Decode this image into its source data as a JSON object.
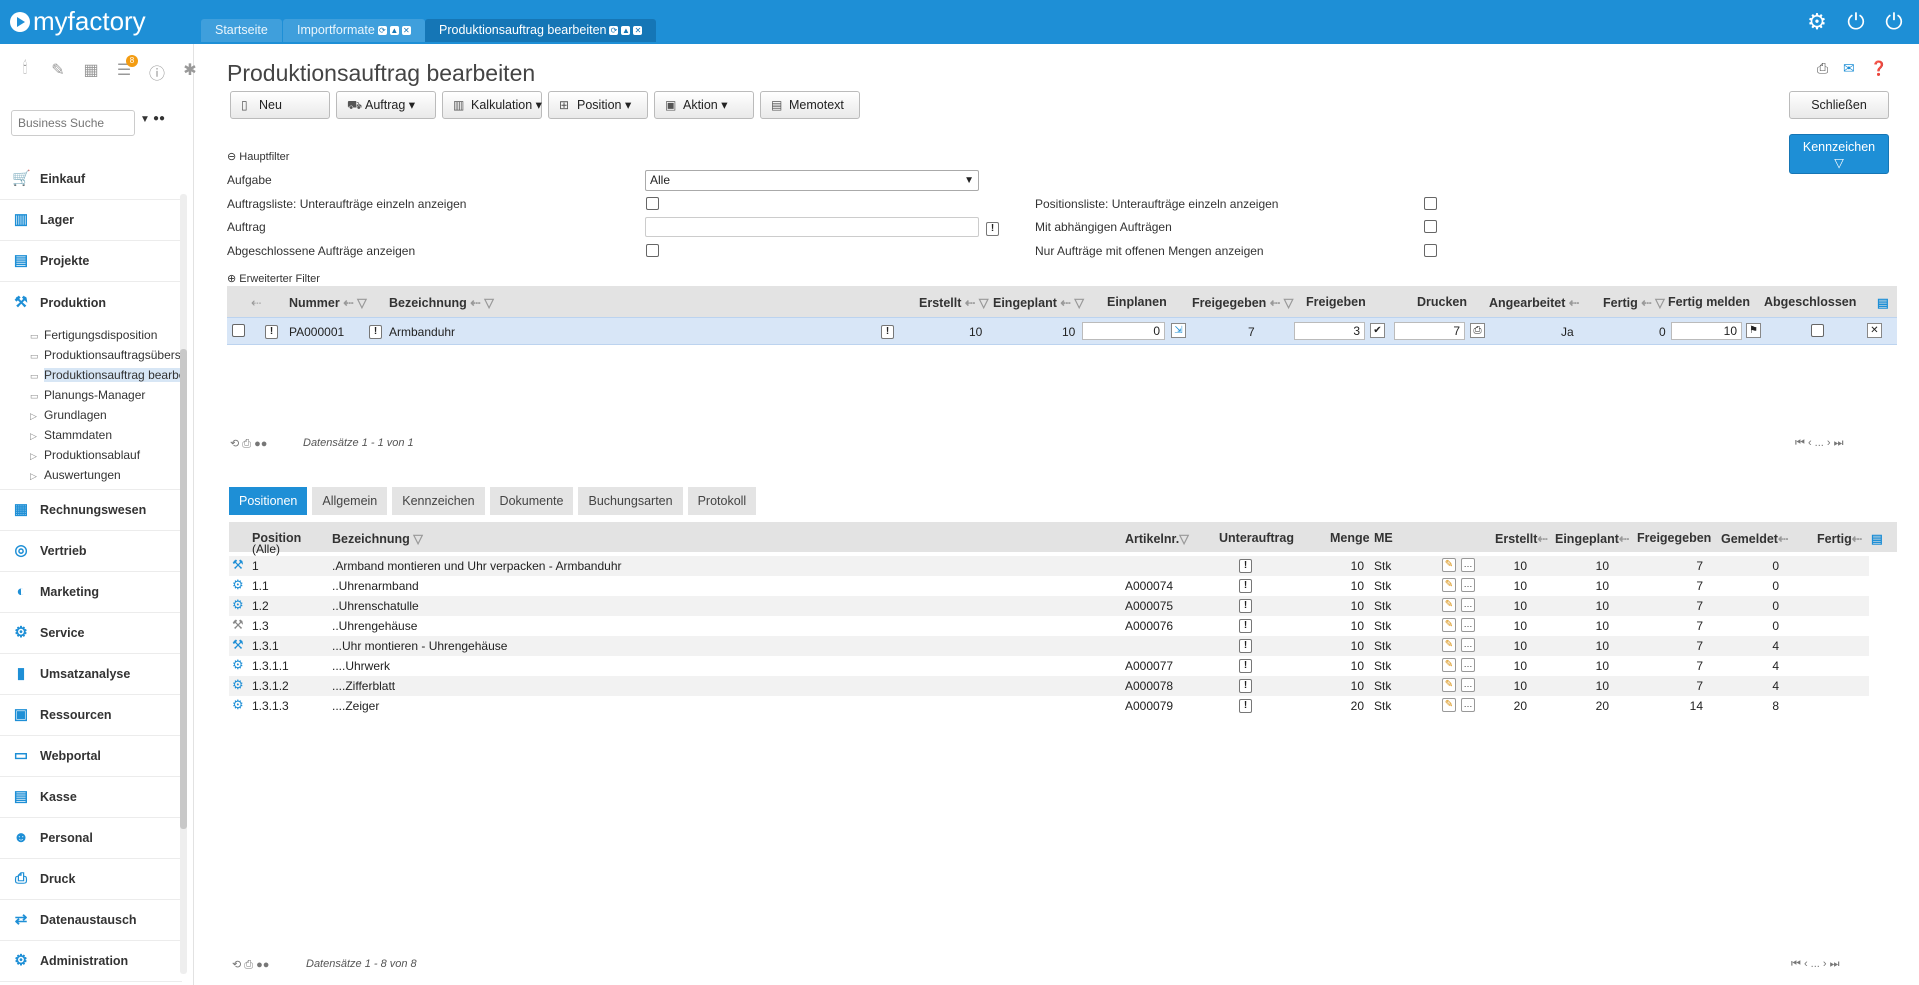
{
  "app": {
    "logo_text": "myfactory",
    "accent": "#1e8fd6"
  },
  "tabs": [
    {
      "label": "Startseite"
    },
    {
      "label": "Importformate"
    },
    {
      "label": "Produktionsauftrag bearbeiten"
    }
  ],
  "sidebar": {
    "badge": "8",
    "search_placeholder": "Business Suche",
    "modules": [
      {
        "label": "Einkauf",
        "icon": "cart-icon"
      },
      {
        "label": "Lager",
        "icon": "warehouse-icon"
      },
      {
        "label": "Projekte",
        "icon": "projects-icon"
      },
      {
        "label": "Produktion",
        "icon": "production-icon"
      }
    ],
    "sub": [
      {
        "label": "Fertigungsdisposition"
      },
      {
        "label": "Produktionsauftragsübers"
      },
      {
        "label": "Produktionsauftrag bearbe"
      },
      {
        "label": "Planungs-Manager"
      },
      {
        "label": "Grundlagen"
      },
      {
        "label": "Stammdaten"
      },
      {
        "label": "Produktionsablauf"
      },
      {
        "label": "Auswertungen"
      }
    ],
    "modules2": [
      {
        "label": "Rechnungswesen",
        "icon": "accounting-icon"
      },
      {
        "label": "Vertrieb",
        "icon": "sales-icon"
      },
      {
        "label": "Marketing",
        "icon": "marketing-icon"
      },
      {
        "label": "Service",
        "icon": "service-icon"
      },
      {
        "label": "Umsatzanalyse",
        "icon": "analysis-icon"
      },
      {
        "label": "Ressourcen",
        "icon": "resources-icon"
      },
      {
        "label": "Webportal",
        "icon": "webportal-icon"
      },
      {
        "label": "Kasse",
        "icon": "cashdesk-icon"
      },
      {
        "label": "Personal",
        "icon": "staff-icon"
      },
      {
        "label": "Druck",
        "icon": "print-icon"
      },
      {
        "label": "Datenaustausch",
        "icon": "exchange-icon"
      },
      {
        "label": "Administration",
        "icon": "admin-icon"
      }
    ]
  },
  "page": {
    "title": "Produktionsauftrag bearbeiten"
  },
  "toolbar": {
    "neu": "Neu",
    "auftrag": "Auftrag",
    "kalkulation": "Kalkulation",
    "position": "Position",
    "aktion": "Aktion",
    "memotext": "Memotext",
    "schliessen": "Schließen",
    "kennzeichen": "Kennzeichen"
  },
  "filter": {
    "hauptfilter": "Hauptfilter",
    "aufgabe_label": "Aufgabe",
    "aufgabe_value": "Alle",
    "auftragsliste_label": "Auftragsliste: Unteraufträge einzeln anzeigen",
    "auftrag_label": "Auftrag",
    "abgeschlossene_label": "Abgeschlossene Aufträge anzeigen",
    "positionsliste_label": "Positionsliste: Unteraufträge einzeln anzeigen",
    "abhaengig_label": "Mit abhängigen Aufträgen",
    "offene_label": "Nur Aufträge mit offenen Mengen anzeigen",
    "erweitert": "Erweiterter Filter"
  },
  "grid": {
    "headers": {
      "nummer": "Nummer",
      "bezeichnung": "Bezeichnung",
      "erstellt": "Erstellt",
      "eingeplant": "Eingeplant",
      "einplanen": "Einplanen",
      "freigegeben": "Freigegeben",
      "freigeben": "Freigeben",
      "drucken": "Drucken",
      "angearbeitet": "Angearbeitet",
      "fertig": "Fertig",
      "fertig_melden": "Fertig melden",
      "abgeschlossen": "Abgeschlossen"
    },
    "row": {
      "nummer": "PA000001",
      "bezeichnung": "Armbanduhr",
      "erstellt": "10",
      "eingeplant": "10",
      "einplanen": "0",
      "freigegeben": "7",
      "freigeben": "3",
      "drucken": "7",
      "angearbeitet": "Ja",
      "fertig": "0",
      "fertig_melden": "10"
    },
    "pager": "Datensätze 1 - 1 von 1"
  },
  "detail_tabs": [
    "Positionen",
    "Allgemein",
    "Kennzeichen",
    "Dokumente",
    "Buchungsarten",
    "Protokoll"
  ],
  "positions": {
    "headers": {
      "position": "Position",
      "bezeichnung": "Bezeichnung",
      "artikelnr": "Artikelnr.",
      "unterauftrag": "Unterauftrag",
      "menge": "Menge",
      "me": "ME",
      "erstellt": "Erstellt",
      "eingeplant": "Eingeplant",
      "freigegeben": "Freigegeben",
      "gemeldet": "Gemeldet",
      "fertig": "Fertig"
    },
    "alle": "(Alle)",
    "rows": [
      {
        "pos": "1",
        "bez": ".Armband montieren und Uhr verpacken - Armbanduhr",
        "art": "",
        "menge": "10",
        "me": "Stk",
        "erstellt": "10",
        "eingeplant": "10",
        "freigegeben": "7",
        "gemeldet": "0"
      },
      {
        "pos": "1.1",
        "bez": "..Uhrenarmband",
        "art": "A000074",
        "menge": "10",
        "me": "Stk",
        "erstellt": "10",
        "eingeplant": "10",
        "freigegeben": "7",
        "gemeldet": "0"
      },
      {
        "pos": "1.2",
        "bez": "..Uhrenschatulle",
        "art": "A000075",
        "menge": "10",
        "me": "Stk",
        "erstellt": "10",
        "eingeplant": "10",
        "freigegeben": "7",
        "gemeldet": "0"
      },
      {
        "pos": "1.3",
        "bez": "..Uhrengehäuse",
        "art": "A000076",
        "menge": "10",
        "me": "Stk",
        "erstellt": "10",
        "eingeplant": "10",
        "freigegeben": "7",
        "gemeldet": "0"
      },
      {
        "pos": "1.3.1",
        "bez": "...Uhr montieren - Uhrengehäuse",
        "art": "",
        "menge": "10",
        "me": "Stk",
        "erstellt": "10",
        "eingeplant": "10",
        "freigegeben": "7",
        "gemeldet": "4"
      },
      {
        "pos": "1.3.1.1",
        "bez": "....Uhrwerk",
        "art": "A000077",
        "menge": "10",
        "me": "Stk",
        "erstellt": "10",
        "eingeplant": "10",
        "freigegeben": "7",
        "gemeldet": "4"
      },
      {
        "pos": "1.3.1.2",
        "bez": "....Zifferblatt",
        "art": "A000078",
        "menge": "10",
        "me": "Stk",
        "erstellt": "10",
        "eingeplant": "10",
        "freigegeben": "7",
        "gemeldet": "4"
      },
      {
        "pos": "1.3.1.3",
        "bez": "....Zeiger",
        "art": "A000079",
        "menge": "20",
        "me": "Stk",
        "erstellt": "20",
        "eingeplant": "20",
        "freigegeben": "14",
        "gemeldet": "8"
      }
    ],
    "pager": "Datensätze 1 - 8 von 8"
  }
}
